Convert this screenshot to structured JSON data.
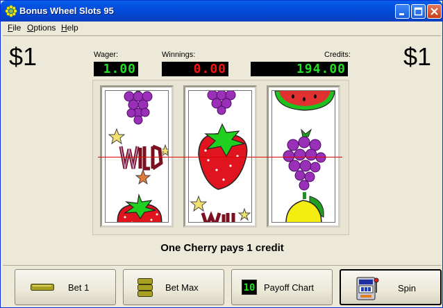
{
  "window": {
    "title": "Bonus Wheel Slots 95"
  },
  "menu": {
    "file": "File",
    "options": "Options",
    "help": "Help"
  },
  "display": {
    "left_bet": "$1",
    "right_bet": "$1",
    "wager_label": "Wager:",
    "wager_value": "1.00",
    "winnings_label": "Winnings:",
    "winnings_value": "0.00",
    "credits_label": "Credits:",
    "credits_value": "194.00"
  },
  "colors": {
    "lcd_green": "#22e022",
    "lcd_red": "#ff1010",
    "payline": "#e00000"
  },
  "reels": [
    {
      "symbols": [
        "grapes",
        "wild-bonus",
        "strawberry"
      ]
    },
    {
      "symbols": [
        "grapes",
        "strawberry",
        "wild-bonus"
      ]
    },
    {
      "symbols": [
        "watermelon",
        "grapes",
        "lemon"
      ]
    }
  ],
  "message": "One Cherry pays 1 credit",
  "buttons": {
    "bet1": "Bet 1",
    "betmax": "Bet Max",
    "payoff": "Payoff Chart",
    "payoff_icon_text": "10",
    "spin": "Spin"
  }
}
